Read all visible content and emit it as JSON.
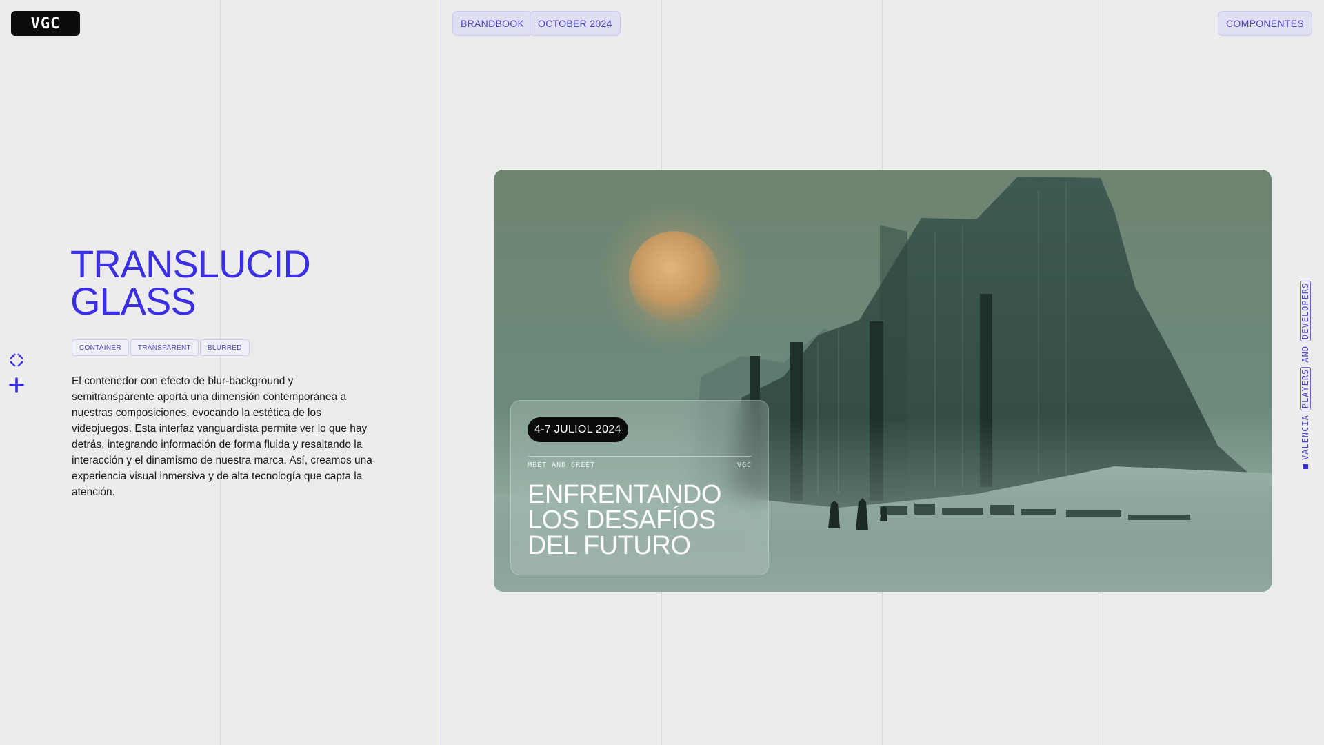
{
  "brand": {
    "logo_text": "VGC"
  },
  "header": {
    "pills": [
      "BRANDBOOK",
      "OCTOBER 2024"
    ],
    "right_pill": "COMPONENTES"
  },
  "section": {
    "title_line1": "TRANSLUCID",
    "title_line2": "GLASS",
    "tags": [
      "CONTAINER",
      "TRANSPARENT",
      "BLURRED"
    ],
    "description": "El contenedor con efecto de blur-background y semitransparente aporta una dimensión contemporánea a nuestras composiciones, evocando la estética de los videojuegos. Esta interfaz vanguardista permite ver lo que hay detrás, integrando información de forma fluida y resaltando la interacción y el dinamismo de nuestra marca. Así, creamos una experiencia visual inmersiva y de alta tecnología que capta la atención."
  },
  "side_icons": [
    "collapse-arrows-icon",
    "plus-icon"
  ],
  "card": {
    "date": "4-7 JULIOL 2024",
    "meta_left": "MEET AND GREET",
    "meta_right": "VGC",
    "title": "ENFRENTANDO LOS DESAFÍOS DEL FUTURO"
  },
  "vertical_label": {
    "word1": "VALENCIA",
    "word2": "PLAYERS",
    "word3": "AND",
    "word4": "DEVELOPERS"
  },
  "colors": {
    "accent": "#3b2fe3",
    "pill_bg": "#dfdff4",
    "background": "#ececec"
  }
}
